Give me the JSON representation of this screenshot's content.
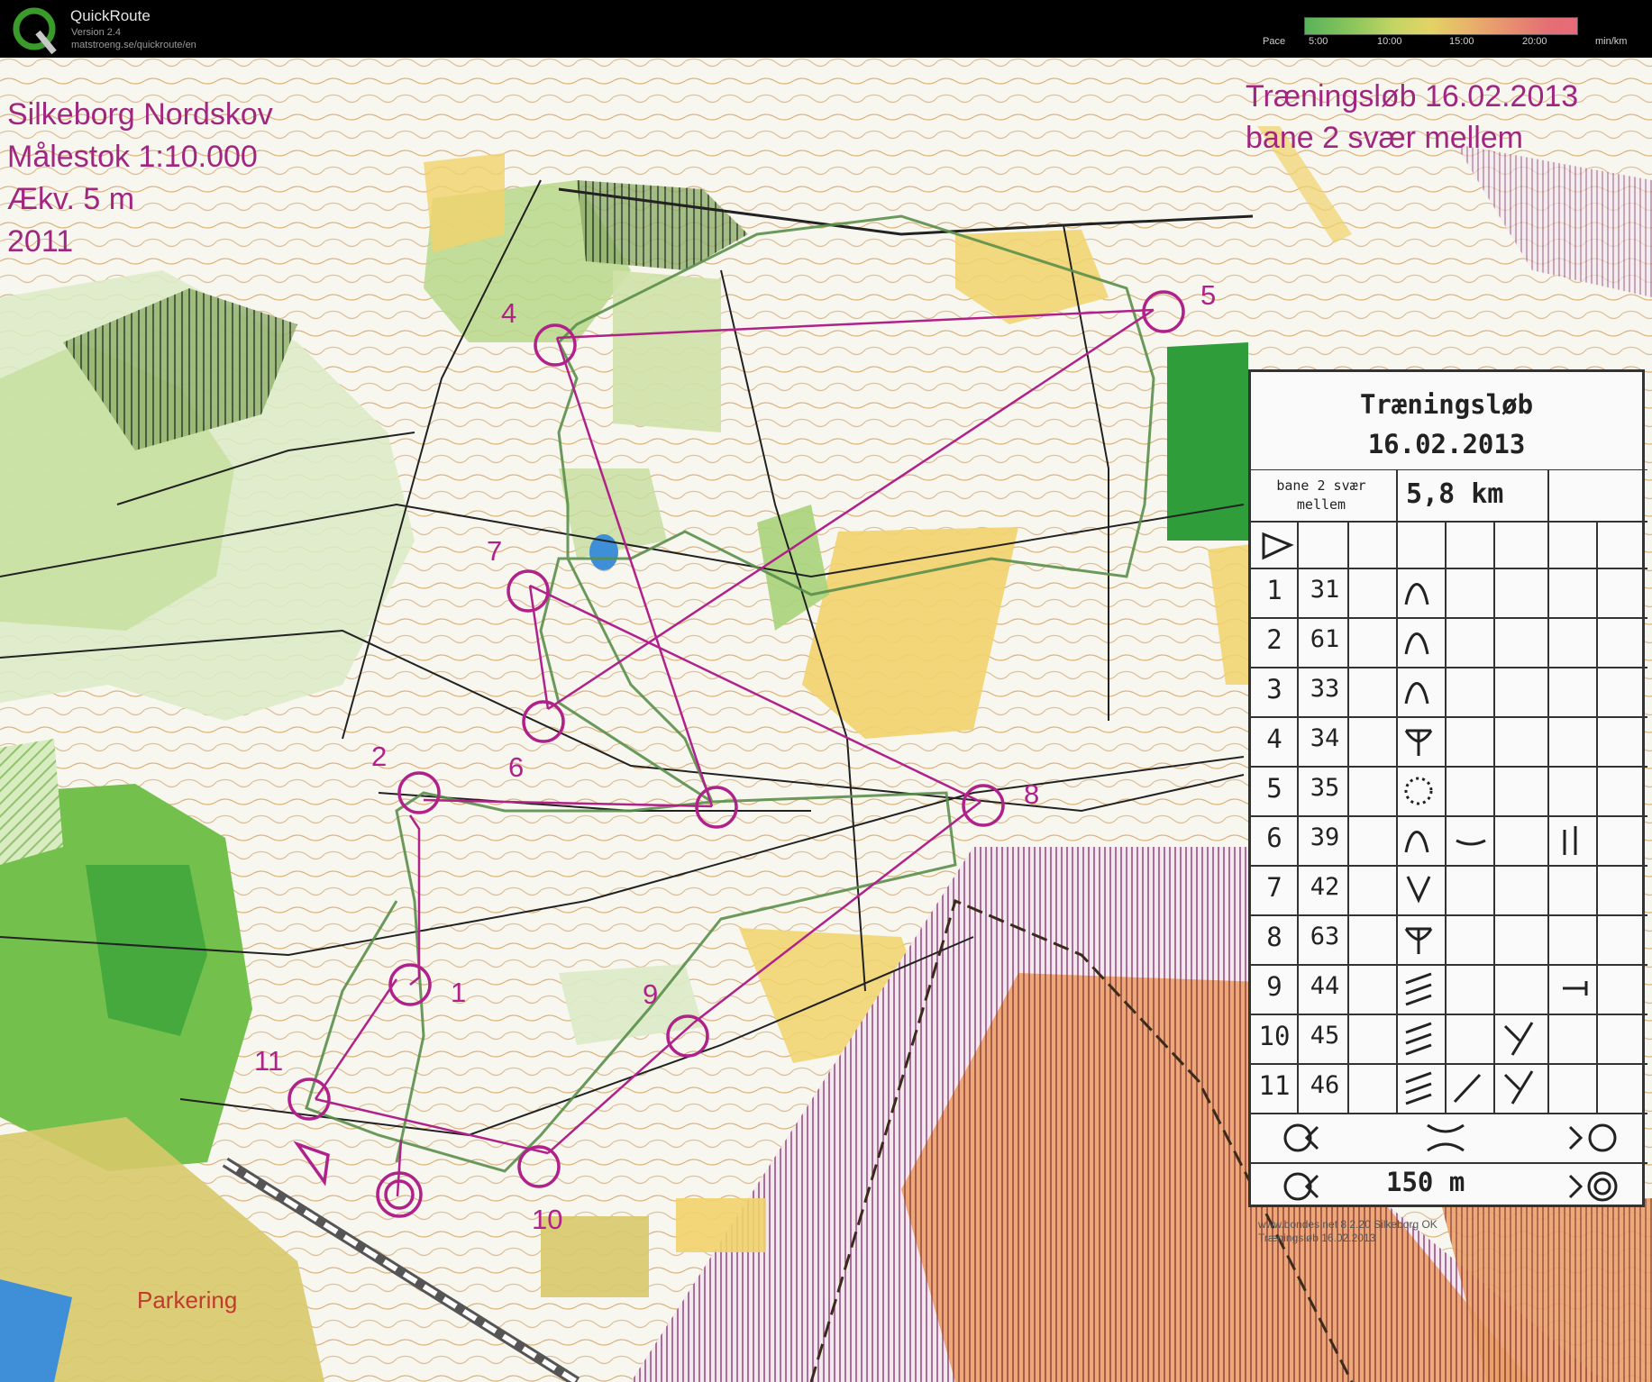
{
  "app": {
    "name": "QuickRoute",
    "version": "Version 2.4",
    "url": "matstroeng.se/quickroute/en"
  },
  "pace_legend": {
    "label": "Pace",
    "ticks": [
      "5:00",
      "10:00",
      "15:00",
      "20:00"
    ],
    "unit": "min/km"
  },
  "map": {
    "title_lines": [
      "Silkeborg Nordskov",
      "Målestok 1:10.000",
      "Ækv. 5 m",
      "2011"
    ],
    "course_title_lines": [
      "Træningsløb 16.02.2013",
      "bane 2 svær mellem"
    ],
    "parking_label": "Parkering",
    "control_labels": [
      "1",
      "2",
      "4",
      "5",
      "6",
      "7",
      "8",
      "9",
      "10",
      "11"
    ],
    "colors": {
      "course_purple": "#b0228a",
      "route_green": "#5a8f4a",
      "open_yellow": "#f1d36b",
      "forest_green": "#6fbf4a",
      "contour_brown": "#c9852d"
    }
  },
  "description": {
    "title_lines": [
      "Træningsløb",
      "16.02.2013"
    ],
    "course_lines": [
      "bane 2 svær",
      "mellem"
    ],
    "length": "5,8 km",
    "rows": [
      {
        "num": "1",
        "code": "31",
        "symbol": "knoll-icon"
      },
      {
        "num": "2",
        "code": "61",
        "symbol": "knoll-icon"
      },
      {
        "num": "3",
        "code": "33",
        "symbol": "knoll-icon"
      },
      {
        "num": "4",
        "code": "34",
        "symbol": "path-junction-icon"
      },
      {
        "num": "5",
        "code": "35",
        "symbol": "dotted-circle-icon"
      },
      {
        "num": "6",
        "code": "39",
        "symbol": "knoll-icon"
      },
      {
        "num": "7",
        "code": "42",
        "symbol": "depression-icon"
      },
      {
        "num": "8",
        "code": "63",
        "symbol": "path-junction-icon"
      },
      {
        "num": "9",
        "code": "44",
        "symbol": "marsh-icon"
      },
      {
        "num": "10",
        "code": "45",
        "symbol": "marsh-icon"
      },
      {
        "num": "11",
        "code": "46",
        "symbol": "marsh-icon"
      }
    ],
    "finish_distance": "150 m",
    "footer_lines": [
      "www.bondes.net 8.2.20 Silkeborg OK",
      "Træningsløb 16.02.2013"
    ]
  }
}
